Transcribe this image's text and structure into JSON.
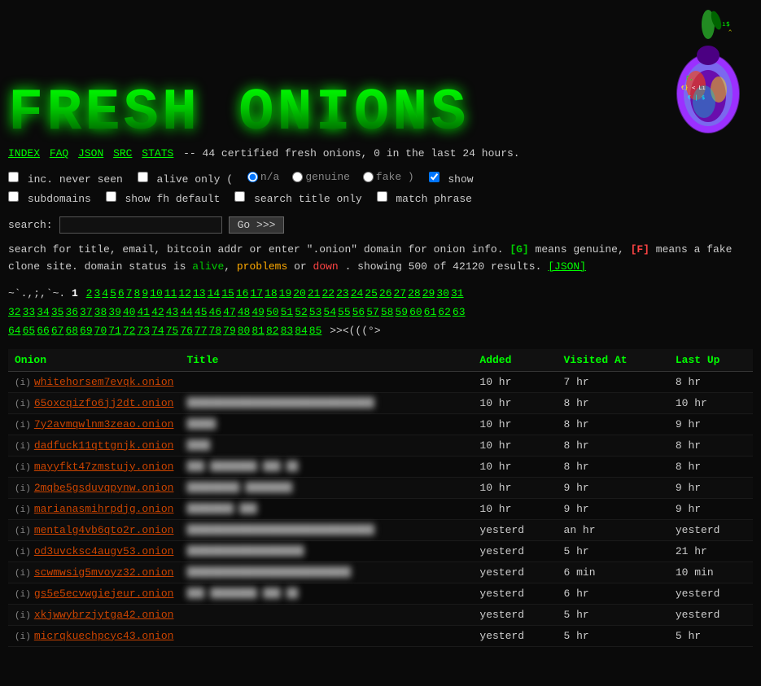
{
  "header": {
    "title": "FRESH ONIONS",
    "logo_alt": "Fresh Onions logo with colorful onion illustration"
  },
  "nav": {
    "index": "INDEX",
    "faq": "FAQ",
    "json": "JSON",
    "src": "SRC",
    "stats": "STATS",
    "summary": "-- 44 certified fresh onions, 0 in the last 24 hours."
  },
  "options": {
    "inc_never_seen": "inc. never seen",
    "alive_only": "alive only (",
    "n_a": "n/a",
    "genuine": "genuine",
    "fake": "fake )",
    "show": "show",
    "show_subdomains": "subdomains",
    "show_fh_default": "show fh default",
    "search_title_only": "search title only",
    "match_phrase": "match phrase"
  },
  "search": {
    "label": "search:",
    "placeholder": "",
    "button": "Go >>>"
  },
  "info": {
    "line1": "search for title, email, bitcoin addr or enter \".onion\" domain for onion info.",
    "genuine_tag": "[G]",
    "genuine_desc": "means genuine,",
    "fake_tag": "[F]",
    "fake_desc": "means a fake clone site. domain status is",
    "alive": "alive",
    "problems": "problems",
    "or": "or",
    "down": "down",
    "showing": ". showing 500 of 42120 results.",
    "json_link": "[JSON]"
  },
  "pagination": {
    "dots_start": "~`.,;,`~.",
    "current": "1",
    "pages": [
      "2",
      "3",
      "4",
      "5",
      "6",
      "7",
      "8",
      "9",
      "10",
      "11",
      "12",
      "13",
      "14",
      "15",
      "16",
      "17",
      "18",
      "19",
      "20",
      "21",
      "22",
      "23",
      "24",
      "25",
      "26",
      "27",
      "28",
      "29",
      "30",
      "31",
      "32",
      "33",
      "34",
      "35",
      "36",
      "37",
      "38",
      "39",
      "40",
      "41",
      "42",
      "43",
      "44",
      "45",
      "46",
      "47",
      "48",
      "49",
      "50",
      "51",
      "52",
      "53",
      "54",
      "55",
      "56",
      "57",
      "58",
      "59",
      "60",
      "61",
      "62",
      "63",
      "64",
      "65",
      "66",
      "67",
      "68",
      "69",
      "70",
      "71",
      "72",
      "73",
      "74",
      "75",
      "76",
      "77",
      "78",
      "79",
      "80",
      "81",
      "82",
      "83",
      "84",
      "85"
    ],
    "emoji": ">><(((°>"
  },
  "table": {
    "headers": {
      "onion": "Onion",
      "title": "Title",
      "added": "Added",
      "visited_at": "Visited At",
      "last_up": "Last Up"
    },
    "rows": [
      {
        "info": "(i)",
        "onion": "whitehorsem7evqk.onion",
        "title": "",
        "added": "10 hr",
        "visited": "7 hr",
        "last_up": "8 hr"
      },
      {
        "info": "(i)",
        "onion": "65oxcqizfo6jj2dt.onion",
        "title": "████████████████████████████████",
        "added": "10 hr",
        "visited": "8 hr",
        "last_up": "10 hr"
      },
      {
        "info": "(i)",
        "onion": "7y2avmqwlnm3zeao.onion",
        "title": "█████",
        "added": "10 hr",
        "visited": "8 hr",
        "last_up": "9 hr"
      },
      {
        "info": "(i)",
        "onion": "dadfuck11qttgnjk.onion",
        "title": "████",
        "added": "10 hr",
        "visited": "8 hr",
        "last_up": "8 hr"
      },
      {
        "info": "(i)",
        "onion": "mayyfkt47zmstujy.onion",
        "title": "███ ████████ ███ ██",
        "added": "10 hr",
        "visited": "8 hr",
        "last_up": "8 hr"
      },
      {
        "info": "(i)",
        "onion": "2mqbe5gsduvqpynw.onion",
        "title": "█████████ ████████",
        "added": "10 hr",
        "visited": "9 hr",
        "last_up": "9 hr"
      },
      {
        "info": "(i)",
        "onion": "marianasmihrpdjg.onion",
        "title": "████████ ███",
        "added": "10 hr",
        "visited": "9 hr",
        "last_up": "9 hr"
      },
      {
        "info": "(i)",
        "onion": "mentalg4vb6qto2r.onion",
        "title": "████████████████████████████████",
        "added": "yesterd",
        "visited": "an hr",
        "last_up": "yesterd"
      },
      {
        "info": "(i)",
        "onion": "od3uvcksc4augv53.onion",
        "title": "████████████████████",
        "added": "yesterd",
        "visited": "5 hr",
        "last_up": "21 hr"
      },
      {
        "info": "(i)",
        "onion": "scwmwsig5mvoyz32.onion",
        "title": "████████████████████████████",
        "added": "yesterd",
        "visited": "6 min",
        "last_up": "10 min"
      },
      {
        "info": "(i)",
        "onion": "gs5e5ecvwgiejeur.onion",
        "title": "███ ████████ ███ ██",
        "added": "yesterd",
        "visited": "6 hr",
        "last_up": "yesterd"
      },
      {
        "info": "(i)",
        "onion": "xkjwwybrzjytga42.onion",
        "title": "",
        "added": "yesterd",
        "visited": "5 hr",
        "last_up": "yesterd"
      },
      {
        "info": "(i)",
        "onion": "micrqkuechpcyc43.onion",
        "title": "",
        "added": "yesterd",
        "visited": "5 hr",
        "last_up": "5 hr"
      }
    ]
  }
}
